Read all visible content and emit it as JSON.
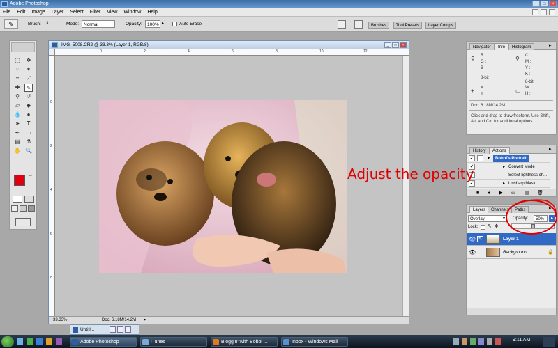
{
  "app": {
    "title": "Adobe Photoshop",
    "menu": [
      "File",
      "Edit",
      "Image",
      "Layer",
      "Select",
      "Filter",
      "View",
      "Window",
      "Help"
    ]
  },
  "options_bar": {
    "brush_label": "Brush:",
    "brush_size": "3",
    "mode_label": "Mode:",
    "mode_value": "Normal",
    "opacity_label": "Opacity:",
    "opacity_value": "100%",
    "auto_erase_label": "Auto Erase",
    "palette_tabs": [
      "Brushes",
      "Tool Presets",
      "Layer Comps"
    ]
  },
  "document": {
    "title": "IMG_5008.CR2 @ 33.3% (Layer 1, RGB/8)",
    "zoom": "33.33%",
    "doc_size": "Doc: 6.18M/14.2M",
    "ruler_h": [
      "0",
      "2",
      "4",
      "6",
      "8",
      "10",
      "12"
    ],
    "ruler_v": [
      "0",
      "2",
      "4",
      "6",
      "8"
    ]
  },
  "info_panel": {
    "tabs": [
      "Navigator",
      "Info",
      "Histogram"
    ],
    "rgb_labels": [
      "R :",
      "G :",
      "B :"
    ],
    "cmyk_labels": [
      "C :",
      "M :",
      "Y :",
      "K :"
    ],
    "bit_left": "8-bit",
    "bit_right": "8-bit",
    "xy_labels": [
      "X :",
      "Y :"
    ],
    "wh_labels": [
      "W :",
      "H :"
    ],
    "doc": "Doc: 6.18M/14.2M",
    "hint": "Click and drag to draw freeform.  Use Shift, Alt, and Ctrl for additional options."
  },
  "actions_panel": {
    "tabs": [
      "History",
      "Actions"
    ],
    "items": [
      "Bobbi's Portrait",
      "Convert Mode",
      "Select lightness ch...",
      "Unsharp Mask"
    ]
  },
  "layers_panel": {
    "tabs": [
      "Layers",
      "Channels",
      "Paths"
    ],
    "blend_mode": "Overlay",
    "opacity_label": "Opacity:",
    "opacity_value": "50%",
    "opacity_fraction": 0.5,
    "lock_label": "Lock:",
    "layers": [
      {
        "name": "Layer 1",
        "selected": true
      },
      {
        "name": "Background",
        "selected": false
      }
    ]
  },
  "annotation": {
    "text": "Adjust the opacity",
    "color": "#e00000"
  },
  "colors": {
    "foreground": "#e00010",
    "background": "#000000",
    "accent": "#316ac5"
  },
  "taskbar": {
    "minimized_doc": "Untitl...",
    "tasks": [
      "Adobe Photoshop",
      "iTunes",
      "Bloggin' with Bobbi ...",
      "Inbox - Windows Mail"
    ],
    "time": "9:11 AM"
  }
}
